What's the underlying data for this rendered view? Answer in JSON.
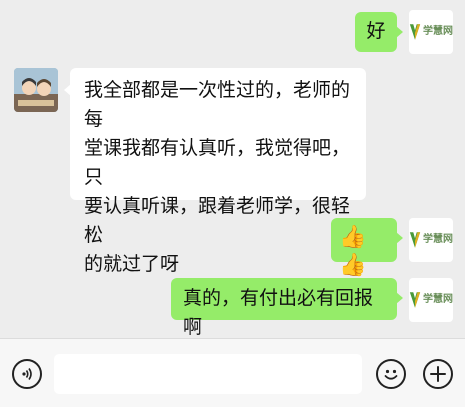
{
  "messages": [
    {
      "side": "right",
      "text": "好",
      "sender_logo": "学慧网"
    },
    {
      "side": "left",
      "text": "我全部都是一次性过的，老师的每堂课我都有认真听，我觉得吧，只要认真听课，跟着老师学，很轻松的就过了呀",
      "lines": [
        "我全部都是一次性过的，老师的每",
        "堂课我都有认真听，我觉得吧，只",
        "要认真听课，跟着老师学，很轻松",
        "的就过了呀"
      ]
    },
    {
      "side": "right",
      "text": "👍👍",
      "sender_logo": "学慧网"
    },
    {
      "side": "right",
      "text": "真的，有付出必有回报啊",
      "sender_logo": "学慧网"
    }
  ],
  "logo": {
    "text": "学慧网",
    "color": "#6a8f5a",
    "accent": "#4a9a3a"
  },
  "input": {
    "placeholder": ""
  },
  "icons": {
    "voice": "voice-icon",
    "emoji": "emoji-icon",
    "plus": "plus-icon",
    "thumbs": "thumbs-up-icon"
  },
  "colors": {
    "bg": "#ededed",
    "bubble_self": "#95ec69",
    "bubble_other": "#ffffff"
  }
}
